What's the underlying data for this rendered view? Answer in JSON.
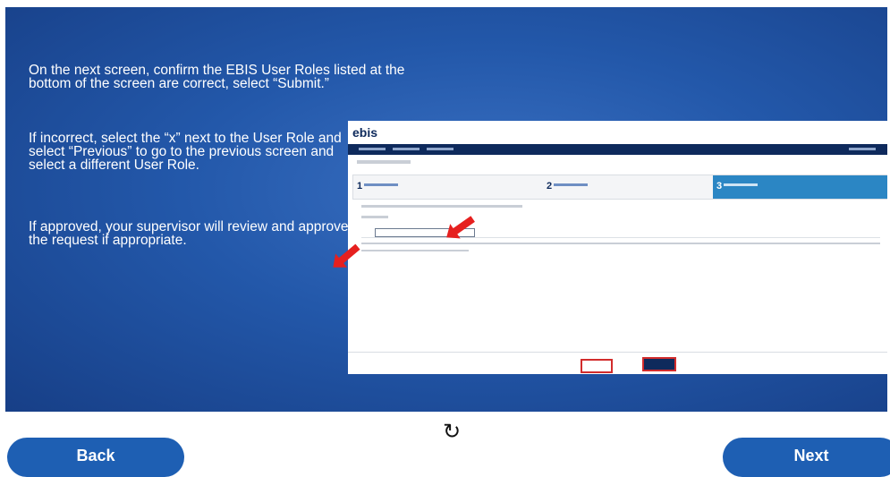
{
  "top_caption": "... ... ... ... ... ... ... ...",
  "slide": {
    "para1": "On the next screen, confirm the EBIS User Roles listed at the bottom of the screen are correct, select “Submit.”",
    "para2": "If incorrect, select the “x” next to the User Role and select “Previous” to go to the previous screen and select a different User Role.",
    "para3": "If approved, your supervisor will review and approve the request if appropriate."
  },
  "screenshot": {
    "logo": "ebis",
    "steps": [
      "1",
      "2",
      "3"
    ]
  },
  "controls": {
    "replay_icon": "replay-icon",
    "back_label": "Back",
    "next_label": "Next"
  },
  "colors": {
    "slide_bg": "#2358aa",
    "button_bg": "#1e5fb3",
    "highlight": "#d22c2c"
  }
}
